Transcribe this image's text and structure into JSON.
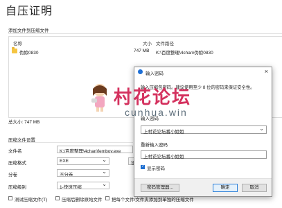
{
  "page": {
    "title": "自压证明"
  },
  "files_section": {
    "label": "添加文件到压缩文件",
    "columns": [
      "名称",
      "大小",
      "文件路径"
    ],
    "rows": [
      {
        "name": "伪娘0830",
        "size": "747 MB",
        "path": "K:\\百度整理\\4chan\\伪娘0830"
      }
    ],
    "total": "总大小: 747 MB"
  },
  "settings_section": {
    "label": "压缩文件设置",
    "filename_label": "文件名",
    "filename_value": "K:\\百度整理\\4chan\\femboy.exe",
    "format_label": "压缩格式",
    "format_value": "EXE",
    "split_label": "分卷",
    "split_value": "不分卷",
    "level_label": "压缩级别",
    "level_value": "1-快速压缩",
    "side_button_label": "设",
    "checkboxes": [
      {
        "label": "测试压缩文件(T)",
        "checked": false
      },
      {
        "label": "压缩后删除原始文件",
        "checked": false
      },
      {
        "label": "把每个文件/文件夹添加到单独的压缩文件",
        "checked": false
      }
    ]
  },
  "dialog": {
    "title": "输入密码",
    "close_glyph": "×",
    "description": "输入压缩包密码。建议使用至少 8 位的密码来保证安全性。",
    "password_label": "输入密码",
    "password_value": "上村花论坛番小姐姐",
    "confirm_label": "重新输入密码",
    "confirm_value": "上村花论坛番小姐姐",
    "show_password_label": "显示密码",
    "show_password_checked": true,
    "buttons": {
      "manager": "密码管理器...",
      "ok": "确定",
      "cancel": "取消"
    }
  },
  "watermark": {
    "title": "村花论坛",
    "subtitle": "cunhua.win"
  },
  "colors": {
    "accent": "#1f6fd1",
    "watermark": "#d4315e"
  }
}
